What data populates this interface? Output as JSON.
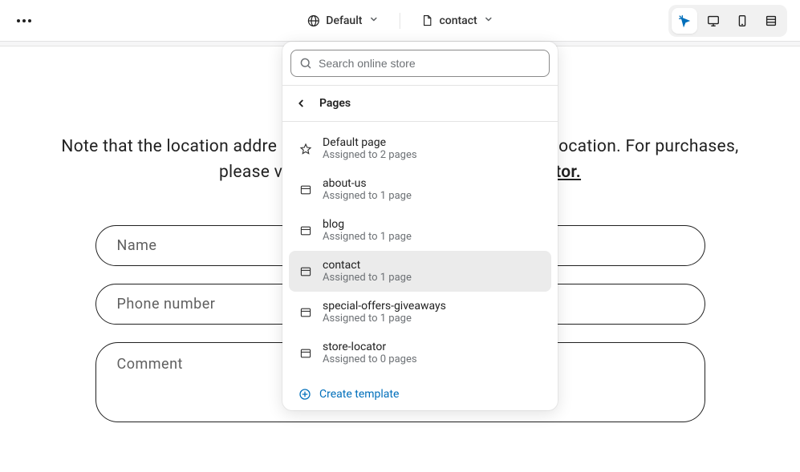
{
  "topbar": {
    "theme_label": "Default",
    "page_label": "contact"
  },
  "intro": {
    "text_left": "Note that the location addre",
    "text_right": "location. For purchases, please v",
    "link_tail": "tor."
  },
  "form": {
    "name_placeholder": "Name",
    "phone_placeholder": "Phone number",
    "comment_placeholder": "Comment"
  },
  "dropdown": {
    "search_placeholder": "Search online store",
    "header": "Pages",
    "create_label": "Create template",
    "templates": [
      {
        "name": "Default page",
        "sub": "Assigned to 2 pages",
        "icon": "star",
        "selected": false
      },
      {
        "name": "about-us",
        "sub": "Assigned to 1 page",
        "icon": "window",
        "selected": false
      },
      {
        "name": "blog",
        "sub": "Assigned to 1 page",
        "icon": "window",
        "selected": false
      },
      {
        "name": "contact",
        "sub": "Assigned to 1 page",
        "icon": "window",
        "selected": true
      },
      {
        "name": "special-offers-giveaways",
        "sub": "Assigned to 1 page",
        "icon": "window",
        "selected": false
      },
      {
        "name": "store-locator",
        "sub": "Assigned to 0 pages",
        "icon": "window",
        "selected": false
      }
    ]
  }
}
